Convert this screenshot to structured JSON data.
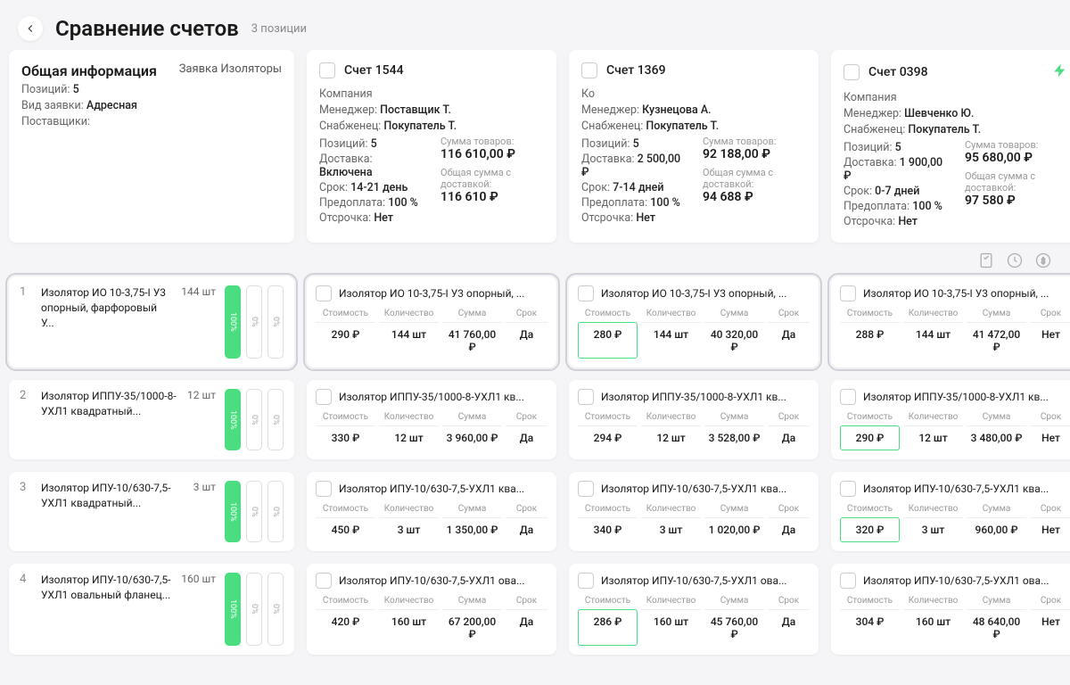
{
  "page": {
    "title": "Сравнение счетов",
    "subtitle": "3 позиции"
  },
  "info": {
    "title": "Общая информация",
    "request_link": "Заявка Изоляторы",
    "positions_label": "Позиций:",
    "positions": "5",
    "type_label": "Вид заявки:",
    "type": "Адресная",
    "suppliers_label": "Поставщики:"
  },
  "accounts": [
    {
      "id": "a1",
      "title": "Счет 1544",
      "company_label": "Компания",
      "manager_label": "Менеджер:",
      "manager": "Поставщик Т.",
      "buyer_label": "Снабженец:",
      "buyer": "Покупатель Т.",
      "pos_label": "Позиций:",
      "pos": "5",
      "delivery_label": "Доставка:",
      "delivery": "Включена",
      "term_label": "Срок:",
      "term": "14-21 день",
      "prepay_label": "Предоплата:",
      "prepay": "100 %",
      "defer_label": "Отсрочка:",
      "defer": "Нет",
      "sum_label": "Сумма товаров:",
      "sum": "116 610,00 ₽",
      "total_label": "Общая сумма с доставкой:",
      "total": "116 610 ₽",
      "bolt": false
    },
    {
      "id": "a2",
      "title": "Счет 1369",
      "company_label": "Ко",
      "manager_label": "Менеджер:",
      "manager": "Кузнецова А.",
      "buyer_label": "Снабженец:",
      "buyer": "Покупатель Т.",
      "pos_label": "Позиций:",
      "pos": "5",
      "delivery_label": "Доставка:",
      "delivery": "2 500,00 ₽",
      "term_label": "Срок:",
      "term": "7-14 дней",
      "prepay_label": "Предоплата:",
      "prepay": "100 %",
      "defer_label": "Отсрочка:",
      "defer": "Нет",
      "sum_label": "Сумма товаров:",
      "sum": "92 188,00 ₽",
      "total_label": "Общая сумма с доставкой:",
      "total": "94 688 ₽",
      "bolt": false
    },
    {
      "id": "a3",
      "title": "Счет 0398",
      "company_label": "Компания",
      "manager_label": "Менеджер:",
      "manager": "Шевченко Ю.",
      "buyer_label": "Снабженец:",
      "buyer": "Покупатель Т.",
      "pos_label": "Позиций:",
      "pos": "5",
      "delivery_label": "Доставка:",
      "delivery": "1 900,00 ₽",
      "term_label": "Срок:",
      "term": "0-7 дней",
      "prepay_label": "Предоплата:",
      "prepay": "100 %",
      "defer_label": "Отсрочка:",
      "defer": "Нет",
      "sum_label": "Сумма товаров:",
      "sum": "95 680,00 ₽",
      "total_label": "Общая сумма с доставкой:",
      "total": "97 580 ₽",
      "bolt": true
    }
  ],
  "hdr": {
    "cost": "Стоимость",
    "qty": "Количество",
    "sum": "Сумма",
    "term": "Срок"
  },
  "bars": {
    "p100": "100%",
    "p0": "0%"
  },
  "items": [
    {
      "idx": "1",
      "name": "Изолятор ИО 10-3,75-I У3 опорный, фарфоровый У...",
      "qty": "144 шт",
      "sel": true,
      "cells": [
        {
          "name": "Изолятор ИО 10-3,75-I У3 опорный, ...",
          "cost": "290 ₽",
          "qty": "144 шт",
          "sum": "41 760,00 ₽",
          "term": "Да",
          "hl": false
        },
        {
          "name": "Изолятор ИО 10-3,75-I У3 опорный, ...",
          "cost": "280 ₽",
          "qty": "144 шт",
          "sum": "40 320,00 ₽",
          "term": "Да",
          "hl": true
        },
        {
          "name": "Изолятор ИО 10-3,75-I У3 опорный, ...",
          "cost": "288 ₽",
          "qty": "144 шт",
          "sum": "41 472,00 ₽",
          "term": "Нет",
          "hl": false
        }
      ]
    },
    {
      "idx": "2",
      "name": "Изолятор ИППУ-35/1000-8-УХЛ1 квадратный...",
      "qty": "12 шт",
      "sel": false,
      "cells": [
        {
          "name": "Изолятор ИППУ-35/1000-8-УХЛ1 кв...",
          "cost": "330 ₽",
          "qty": "12 шт",
          "sum": "3 960,00 ₽",
          "term": "Да",
          "hl": false
        },
        {
          "name": "Изолятор ИППУ-35/1000-8-УХЛ1 кв...",
          "cost": "294 ₽",
          "qty": "12 шт",
          "sum": "3 528,00 ₽",
          "term": "Да",
          "hl": false
        },
        {
          "name": "Изолятор ИППУ-35/1000-8-УХЛ1 кв...",
          "cost": "290 ₽",
          "qty": "12 шт",
          "sum": "3 480,00 ₽",
          "term": "Нет",
          "hl": true
        }
      ]
    },
    {
      "idx": "3",
      "name": "Изолятор ИПУ-10/630-7,5-УХЛ1 квадратный...",
      "qty": "3 шт",
      "sel": false,
      "cells": [
        {
          "name": "Изолятор ИПУ-10/630-7,5-УХЛ1 ква...",
          "cost": "450 ₽",
          "qty": "3 шт",
          "sum": "1 350,00 ₽",
          "term": "Да",
          "hl": false
        },
        {
          "name": "Изолятор ИПУ-10/630-7,5-УХЛ1 ква...",
          "cost": "340 ₽",
          "qty": "3 шт",
          "sum": "1 020,00 ₽",
          "term": "Да",
          "hl": false
        },
        {
          "name": "Изолятор ИПУ-10/630-7,5-УХЛ1 ква...",
          "cost": "320 ₽",
          "qty": "3 шт",
          "sum": "960,00 ₽",
          "term": "Нет",
          "hl": true
        }
      ]
    },
    {
      "idx": "4",
      "name": "Изолятор ИПУ-10/630-7,5-УХЛ1 овальный фланец...",
      "qty": "160 шт",
      "sel": false,
      "cells": [
        {
          "name": "Изолятор ИПУ-10/630-7,5-УХЛ1 ова...",
          "cost": "420 ₽",
          "qty": "160 шт",
          "sum": "67 200,00 ₽",
          "term": "Да",
          "hl": false
        },
        {
          "name": "Изолятор ИПУ-10/630-7,5-УХЛ1 ова...",
          "cost": "286 ₽",
          "qty": "160 шт",
          "sum": "45 760,00 ₽",
          "term": "Да",
          "hl": true
        },
        {
          "name": "Изолятор ИПУ-10/630-7,5-УХЛ1 ова...",
          "cost": "304 ₽",
          "qty": "160 шт",
          "sum": "48 640,00 ₽",
          "term": "Нет",
          "hl": false
        }
      ]
    }
  ]
}
